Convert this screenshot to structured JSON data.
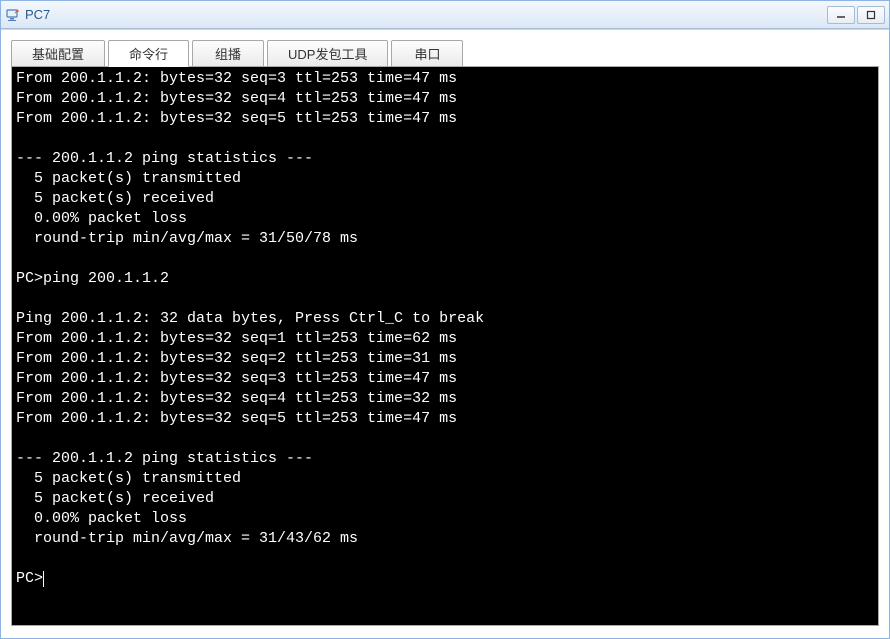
{
  "window": {
    "title": "PC7"
  },
  "tabs": [
    {
      "label": "基础配置"
    },
    {
      "label": "命令行"
    },
    {
      "label": "组播"
    },
    {
      "label": "UDP发包工具"
    },
    {
      "label": "串口"
    }
  ],
  "terminal": {
    "lines": [
      "From 200.1.1.2: bytes=32 seq=3 ttl=253 time=47 ms",
      "From 200.1.1.2: bytes=32 seq=4 ttl=253 time=47 ms",
      "From 200.1.1.2: bytes=32 seq=5 ttl=253 time=47 ms",
      "",
      "--- 200.1.1.2 ping statistics ---",
      "  5 packet(s) transmitted",
      "  5 packet(s) received",
      "  0.00% packet loss",
      "  round-trip min/avg/max = 31/50/78 ms",
      "",
      "PC>ping 200.1.1.2",
      "",
      "Ping 200.1.1.2: 32 data bytes, Press Ctrl_C to break",
      "From 200.1.1.2: bytes=32 seq=1 ttl=253 time=62 ms",
      "From 200.1.1.2: bytes=32 seq=2 ttl=253 time=31 ms",
      "From 200.1.1.2: bytes=32 seq=3 ttl=253 time=47 ms",
      "From 200.1.1.2: bytes=32 seq=4 ttl=253 time=32 ms",
      "From 200.1.1.2: bytes=32 seq=5 ttl=253 time=47 ms",
      "",
      "--- 200.1.1.2 ping statistics ---",
      "  5 packet(s) transmitted",
      "  5 packet(s) received",
      "  0.00% packet loss",
      "  round-trip min/avg/max = 31/43/62 ms",
      ""
    ],
    "prompt": "PC>"
  }
}
